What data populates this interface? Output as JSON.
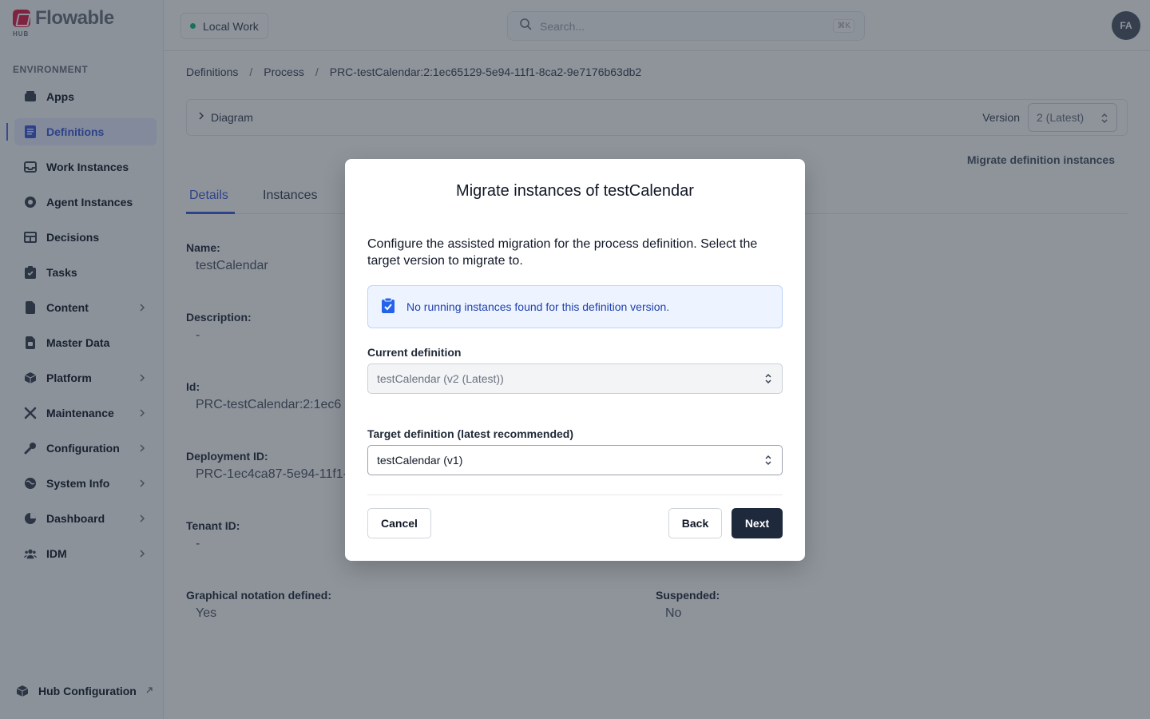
{
  "brand": {
    "name": "Flowable",
    "sub": "HUB",
    "color": "#e11d48"
  },
  "sidebar": {
    "section_label": "ENVIRONMENT",
    "items": [
      {
        "label": "Apps",
        "icon": "apps-icon",
        "chevron": false,
        "active": false
      },
      {
        "label": "Definitions",
        "icon": "definitions-icon",
        "chevron": false,
        "active": true
      },
      {
        "label": "Work Instances",
        "icon": "inbox-icon",
        "chevron": false,
        "active": false
      },
      {
        "label": "Agent Instances",
        "icon": "agent-icon",
        "chevron": false,
        "active": false
      },
      {
        "label": "Decisions",
        "icon": "table-icon",
        "chevron": false,
        "active": false
      },
      {
        "label": "Tasks",
        "icon": "clipboard-icon",
        "chevron": false,
        "active": false
      },
      {
        "label": "Content",
        "icon": "document-icon",
        "chevron": true,
        "active": false
      },
      {
        "label": "Master Data",
        "icon": "database-icon",
        "chevron": false,
        "active": false
      },
      {
        "label": "Platform",
        "icon": "cube-icon",
        "chevron": true,
        "active": false
      },
      {
        "label": "Maintenance",
        "icon": "tools-icon",
        "chevron": true,
        "active": false
      },
      {
        "label": "Configuration",
        "icon": "wrench-icon",
        "chevron": true,
        "active": false
      },
      {
        "label": "System Info",
        "icon": "globe-icon",
        "chevron": true,
        "active": false
      },
      {
        "label": "Dashboard",
        "icon": "pie-chart-icon",
        "chevron": true,
        "active": false
      },
      {
        "label": "IDM",
        "icon": "users-icon",
        "chevron": true,
        "active": false
      }
    ],
    "footer_label": "Hub Configuration"
  },
  "topbar": {
    "environment": "Local Work",
    "environment_color": "#10b981",
    "search_placeholder": "Search...",
    "search_shortcut": "⌘K",
    "avatar_initials": "FA"
  },
  "breadcrumb": {
    "items": [
      "Definitions",
      "Process",
      "PRC-testCalendar:2:1ec65129-5e94-11f1-8ca2-9e7176b63db2"
    ],
    "separator": "/"
  },
  "diagram": {
    "label": "Diagram",
    "version_label": "Version",
    "version_value": "2 (Latest)"
  },
  "actions": {
    "migrate": "Migrate definition instances"
  },
  "tabs": [
    "Details",
    "Instances"
  ],
  "details": {
    "name_label": "Name:",
    "name_value": "testCalendar",
    "description_label": "Description:",
    "description_value": "-",
    "id_label": "Id:",
    "id_value": "PRC-testCalendar:2:1ec6",
    "deployment_label": "Deployment ID:",
    "deployment_value": "PRC-1ec4ca87-5e94-11f1-",
    "tenant_label": "Tenant ID:",
    "tenant_value": "-",
    "graphical_label": "Graphical notation defined:",
    "graphical_value": "Yes",
    "suspended_label": "Suspended:",
    "suspended_value": "No"
  },
  "modal": {
    "title": "Migrate instances of testCalendar",
    "description": "Configure the assisted migration for the process definition. Select the target version to migrate to.",
    "info": "No running instances found for this definition version.",
    "current_label": "Current definition",
    "current_value": "testCalendar (v2 (Latest))",
    "target_label": "Target definition (latest recommended)",
    "target_value": "testCalendar (v1)",
    "cancel": "Cancel",
    "back": "Back",
    "next": "Next"
  }
}
